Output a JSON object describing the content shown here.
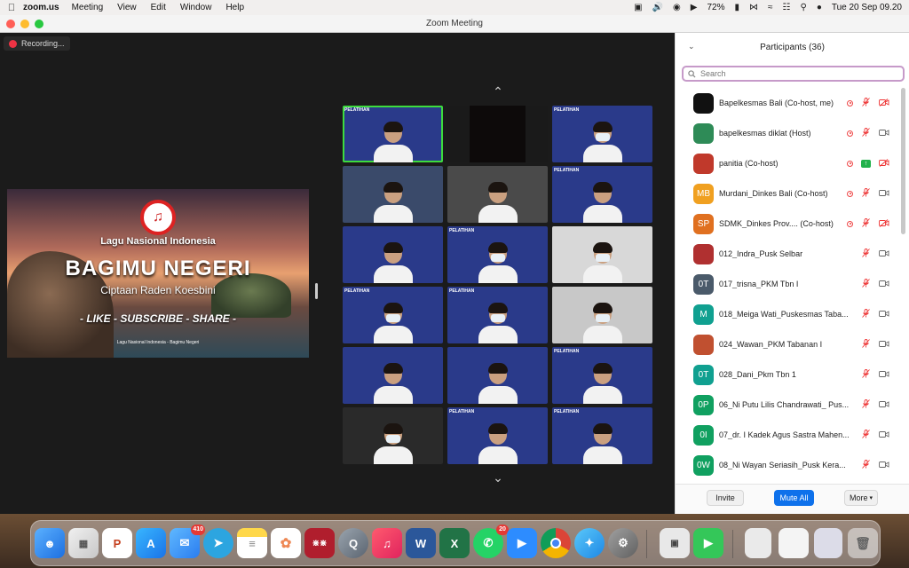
{
  "menubar": {
    "app": "zoom.us",
    "menus": [
      "Meeting",
      "View",
      "Edit",
      "Window",
      "Help"
    ],
    "battery": "72%",
    "datetime": "Tue 20 Sep  09.20"
  },
  "window": {
    "title": "Zoom Meeting"
  },
  "recording": {
    "label": "Recording..."
  },
  "share_screen": {
    "line1": "Lagu Nasional Indonesia",
    "line2": "BAGIMU NEGERI",
    "line3": "Ciptaan Raden Koesbini",
    "line4": "- LIKE - SUBSCRIBE - SHARE -",
    "line5": "Lagu Nasional Indonesia - Bagimu Negeri"
  },
  "gallery": {
    "banner_text": "PELATIHAN",
    "tiles": 18,
    "active_tile": 0
  },
  "panel": {
    "title": "Participants (36)",
    "search_placeholder": "Search",
    "participants": [
      {
        "name": "Bapelkesmas Bali (Co-host, me)",
        "initials": "",
        "color": "#111111",
        "rec": true,
        "mic": "muted",
        "cam": "off-red"
      },
      {
        "name": "bapelkesmas diklat (Host)",
        "initials": "",
        "color": "#2e8b57",
        "rec": true,
        "mic": "muted",
        "cam": "on"
      },
      {
        "name": "panitia (Co-host)",
        "initials": "",
        "color": "#c0392b",
        "rec": true,
        "mic": "share",
        "cam": "off-red"
      },
      {
        "name": "Murdani_Dinkes Bali (Co-host)",
        "initials": "MB",
        "color": "#f0a020",
        "rec": true,
        "mic": "muted",
        "cam": "on"
      },
      {
        "name": "SDMK_Dinkes Prov....  (Co-host)",
        "initials": "SP",
        "color": "#e07020",
        "rec": true,
        "mic": "muted",
        "cam": "off-red"
      },
      {
        "name": "012_Indra_Pusk Selbar",
        "initials": "",
        "color": "#b03030",
        "rec": false,
        "mic": "muted",
        "cam": "on"
      },
      {
        "name": "017_trisna_PKM Tbn I",
        "initials": "0T",
        "color": "#4a5a6a",
        "rec": false,
        "mic": "muted",
        "cam": "on"
      },
      {
        "name": "018_Meiga Wati_Puskesmas Taba...",
        "initials": "M",
        "color": "#10a090",
        "rec": false,
        "mic": "muted",
        "cam": "on"
      },
      {
        "name": "024_Wawan_PKM Tabanan I",
        "initials": "",
        "color": "#c05030",
        "rec": false,
        "mic": "muted",
        "cam": "on"
      },
      {
        "name": "028_Dani_Pkm Tbn 1",
        "initials": "0T",
        "color": "#10a090",
        "rec": false,
        "mic": "muted",
        "cam": "on"
      },
      {
        "name": "06_Ni Putu Lilis Chandrawati_ Pus...",
        "initials": "0P",
        "color": "#10a060",
        "rec": false,
        "mic": "muted",
        "cam": "on"
      },
      {
        "name": "07_dr. I Kadek Agus Sastra Mahen...",
        "initials": "0I",
        "color": "#10a060",
        "rec": false,
        "mic": "muted",
        "cam": "on"
      },
      {
        "name": "08_Ni Wayan Seriasih_Pusk Kera...",
        "initials": "0W",
        "color": "#10a060",
        "rec": false,
        "mic": "muted",
        "cam": "on"
      }
    ],
    "buttons": {
      "invite": "Invite",
      "mute_all": "Mute All",
      "more": "More"
    }
  },
  "dock": {
    "mail_badge": "410",
    "whatsapp_badge": "20"
  }
}
